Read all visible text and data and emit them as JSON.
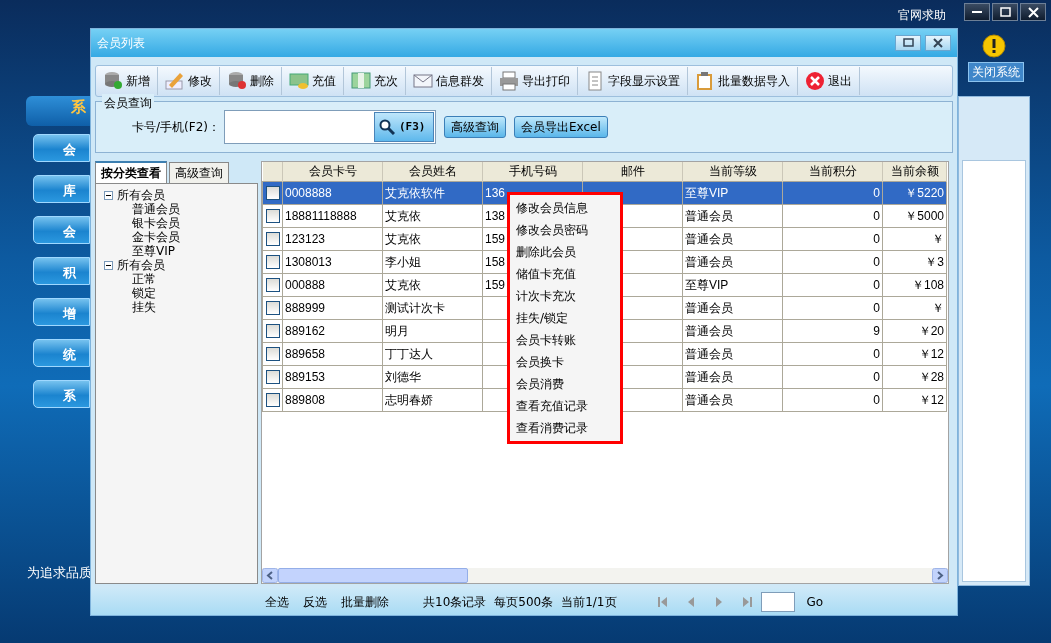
{
  "app": {
    "help_link": "官网求助",
    "close_system": "关闭系统",
    "sidebar_header": "系",
    "slogan": "为追求品质",
    "sidebar_items": [
      "会",
      "库",
      "会",
      "积",
      "增",
      "统",
      "系"
    ]
  },
  "window": {
    "title": "会员列表"
  },
  "toolbar": [
    "新增",
    "修改",
    "删除",
    "充值",
    "充次",
    "信息群发",
    "导出打印",
    "字段显示设置",
    "批量数据导入",
    "退出"
  ],
  "query": {
    "group_title": "会员查询",
    "field_label": "卡号/手机(F2)：",
    "search_button": "(F3)",
    "buttons": [
      "高级查询",
      "会员导出Excel"
    ]
  },
  "left_tabs": [
    {
      "label": "按分类查看",
      "selected": true
    },
    {
      "label": "高级查询",
      "selected": false
    }
  ],
  "tree": [
    {
      "label": "所有会员",
      "expanded": true,
      "children": [
        {
          "label": "普通会员"
        },
        {
          "label": "银卡会员"
        },
        {
          "label": "金卡会员"
        },
        {
          "label": "至尊VIP"
        }
      ]
    },
    {
      "label": "所有会员",
      "expanded": true,
      "children": [
        {
          "label": "正常"
        },
        {
          "label": "锁定"
        },
        {
          "label": "挂失"
        }
      ]
    }
  ],
  "table": {
    "columns": [
      "会员卡号",
      "会员姓名",
      "手机号码",
      "邮件",
      "当前等级",
      "当前积分",
      "当前余额"
    ],
    "rows": [
      {
        "selected": true,
        "checked": false,
        "cells": [
          "0008888",
          "艾克依软件",
          "136",
          "",
          "至尊VIP",
          "0",
          "￥5220"
        ]
      },
      {
        "selected": false,
        "checked": false,
        "cells": [
          "18881118888",
          "艾克依",
          "138",
          "",
          "普通会员",
          "0",
          "￥5000"
        ]
      },
      {
        "selected": false,
        "checked": false,
        "cells": [
          "123123",
          "艾克依",
          "159",
          "",
          "普通会员",
          "0",
          "￥"
        ]
      },
      {
        "selected": false,
        "checked": false,
        "cells": [
          "1308013",
          "李小姐",
          "158",
          "",
          "普通会员",
          "0",
          "￥3"
        ]
      },
      {
        "selected": false,
        "checked": false,
        "cells": [
          "000888",
          "艾克依",
          "159",
          "",
          "至尊VIP",
          "0",
          "￥108"
        ]
      },
      {
        "selected": false,
        "checked": false,
        "cells": [
          "888999",
          "测试计次卡",
          "",
          "",
          "普通会员",
          "0",
          "￥"
        ]
      },
      {
        "selected": false,
        "checked": false,
        "cells": [
          "889162",
          "明月",
          "",
          "",
          "普通会员",
          "9",
          "￥20"
        ]
      },
      {
        "selected": false,
        "checked": false,
        "cells": [
          "889658",
          "丁丁达人",
          "",
          "",
          "普通会员",
          "0",
          "￥12"
        ]
      },
      {
        "selected": false,
        "checked": false,
        "cells": [
          "889153",
          "刘德华",
          "",
          "",
          "普通会员",
          "0",
          "￥28"
        ]
      },
      {
        "selected": false,
        "checked": false,
        "cells": [
          "889808",
          "志明春娇",
          "",
          "",
          "普通会员",
          "0",
          "￥12"
        ]
      }
    ]
  },
  "context_menu": [
    "修改会员信息",
    "修改会员密码",
    "删除此会员",
    "储值卡充值",
    "计次卡充次",
    "挂失/锁定",
    "会员卡转账",
    "会员换卡",
    "会员消费",
    "查看充值记录",
    "查看消费记录"
  ],
  "footer": {
    "links": [
      "全选",
      "反选",
      "批量删除"
    ],
    "summary": [
      "共10条记录",
      "每页500条",
      "当前1/1页"
    ],
    "go": "Go"
  }
}
